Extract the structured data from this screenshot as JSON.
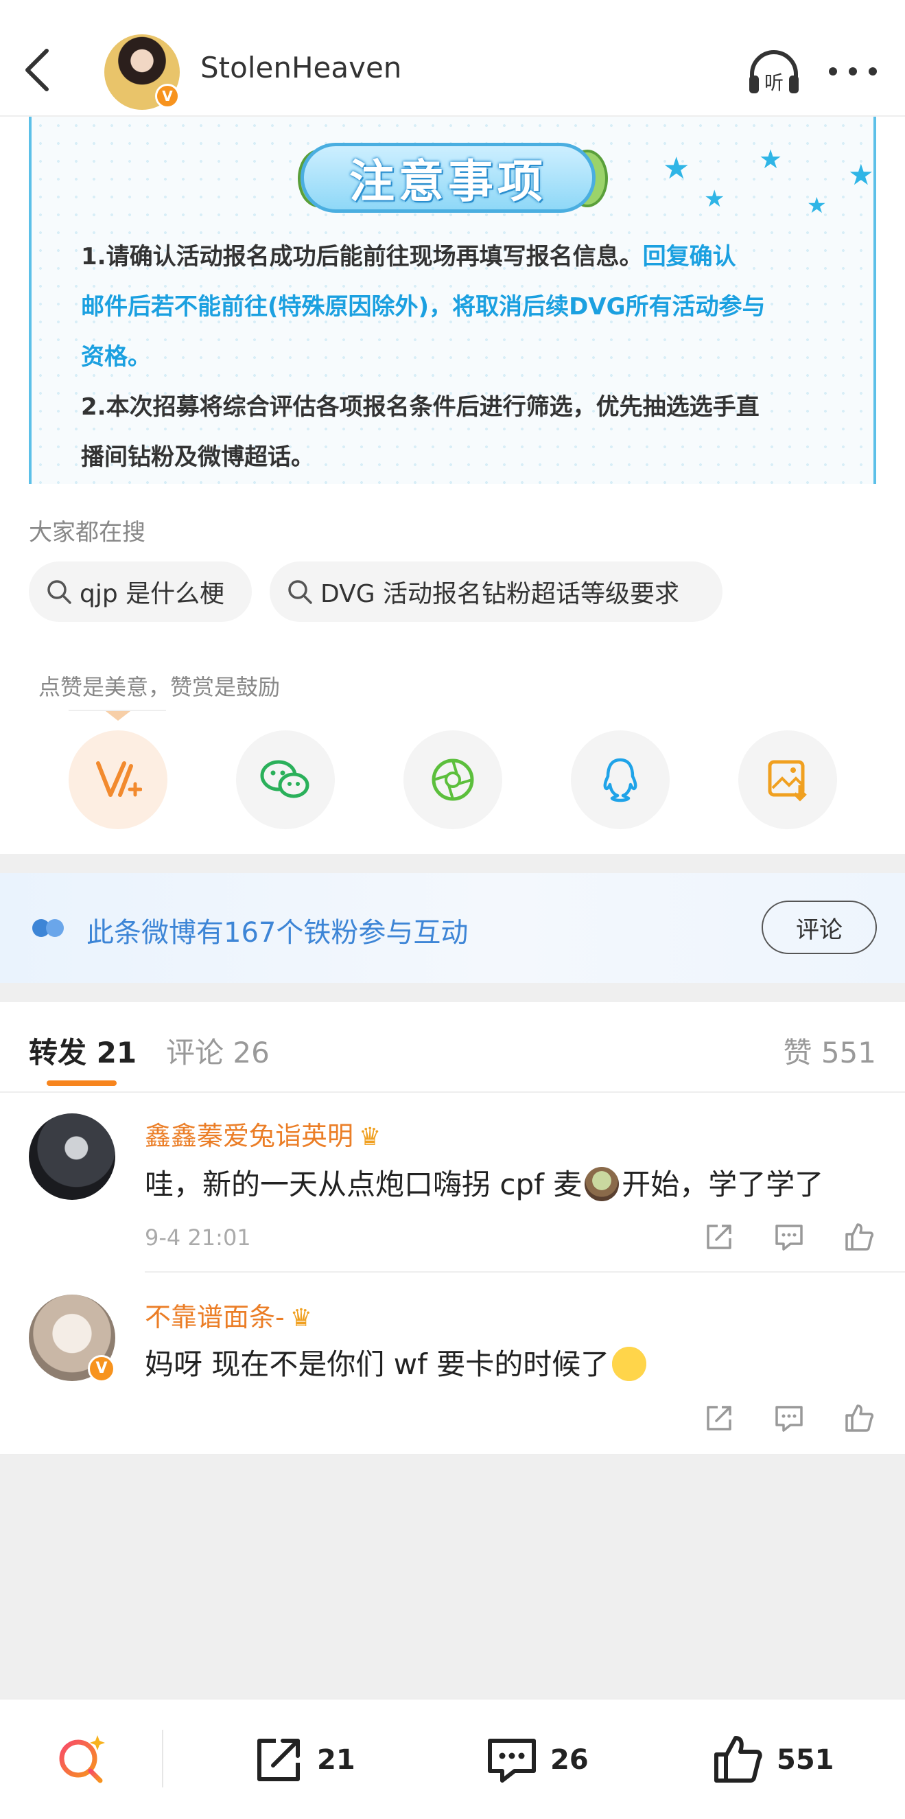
{
  "nav": {
    "username": "StolenHeaven",
    "verified_badge": "V",
    "listen_label": "听"
  },
  "notice": {
    "title": "注意事项",
    "line1_black": "1.请确认活动报名成功后能前往现场再填写报名信息。",
    "line1_blue": "回复确认",
    "line2_blue": "邮件后若不能前往(特殊原因除外)，将取消后续DVG所有活动参与",
    "line3_blue": "资格。",
    "line4": "2.本次招募将综合评估各项报名条件后进行筛选，优先抽选选手直",
    "line5": "播间钻粉及微博超话。"
  },
  "hot_search": {
    "label": "大家都在搜",
    "chips": [
      "qjp 是什么梗",
      "DVG 活动报名钻粉超话等级要求"
    ]
  },
  "reward": {
    "tip": "点赞是美意，赞赏是鼓励",
    "buttons": [
      "reward-icon",
      "wechat-icon",
      "moments-icon",
      "qq-icon",
      "save-image-icon"
    ]
  },
  "fans_bar": {
    "text": "此条微博有167个铁粉参与互动",
    "button": "评论"
  },
  "tabs": {
    "repost_label": "转发",
    "repost_count": "21",
    "comment_label": "评论",
    "comment_count": "26",
    "like_label": "赞",
    "like_count": "551"
  },
  "comments": [
    {
      "name": "鑫鑫蓁爱兔诣英明",
      "text_before": "哇，新的一天从点炮口嗨拐 cpf 麦",
      "text_after": "开始，学了学了",
      "time": "9-4 21:01"
    },
    {
      "name": "不靠谱面条-",
      "text_before": "妈呀 现在不是你们 wf 要卡的时候了",
      "text_after": "",
      "time": ""
    }
  ],
  "bottom_bar": {
    "repost_count": "21",
    "comment_count": "26",
    "like_count": "551"
  },
  "colors": {
    "accent_orange": "#f7851e",
    "username_orange": "#eb7e27",
    "fans_blue": "#3d85d6",
    "notice_blue": "#1ba0e0"
  }
}
